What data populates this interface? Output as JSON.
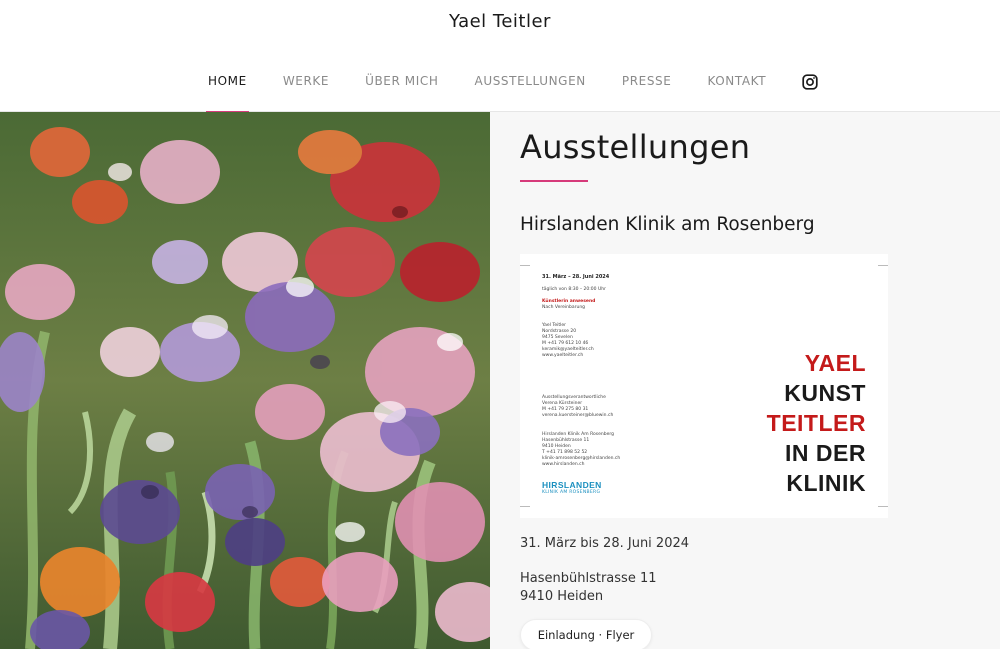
{
  "site": {
    "title": "Yael Teitler"
  },
  "nav": {
    "items": [
      {
        "label": "HOME",
        "active": true
      },
      {
        "label": "WERKE",
        "active": false
      },
      {
        "label": "ÜBER MICH",
        "active": false
      },
      {
        "label": "AUSSTELLUNGEN",
        "active": false
      },
      {
        "label": "PRESSE",
        "active": false
      },
      {
        "label": "KONTAKT",
        "active": false
      }
    ],
    "social_icon": "instagram-icon"
  },
  "hero": {
    "icon": "flower-painting-image"
  },
  "main": {
    "page_title": "Ausstellungen",
    "exhibition": {
      "title": "Hirslanden Klinik am Rosenberg",
      "flyer": {
        "dates_heading": "31. März – 28. Juni 2024",
        "hours": "täglich von 8:30 – 20:00 Uhr",
        "artist_present": "Künstlerin anwesend",
        "by_appointment": "Nach Vereinbarung",
        "artist_contact": [
          "Yael Teitler",
          "Nordstrasse 20",
          "9475 Sevelen",
          "M +41 79 612 10 46",
          "keramik@yaelteitler.ch",
          "www.yaelteitler.ch"
        ],
        "curator_contact": [
          "Ausstellungsverantwortliche",
          "Verena Kürsteiner",
          "M +41 79 275 80 31",
          "verena.kuersteiner@bluewin.ch"
        ],
        "clinic_contact": [
          "Hirslanden Klinik Am Rosenberg",
          "Hasenbühlstrasse 11",
          "9410 Heiden",
          "T +41 71 898 52 52",
          "klinik-amrosenberg@hirslanden.ch",
          "www.hirslanden.ch"
        ],
        "logo_text": "HIRSLANDEN",
        "logo_sub": "KLINIK AM ROSENBERG",
        "headline": [
          "YAEL",
          "KUNST",
          "TEITLER",
          "IN DER",
          "KLINIK"
        ]
      },
      "dates": "31. März bis 28. Juni 2024",
      "address_line1": "Hasenbühlstrasse 11",
      "address_line2": "9410 Heiden",
      "button_label": "Einladung · Flyer"
    }
  },
  "colors": {
    "accent": "#d63a7a",
    "flyer_red": "#c41a1a",
    "hirslanden_blue": "#1a8fbf"
  }
}
